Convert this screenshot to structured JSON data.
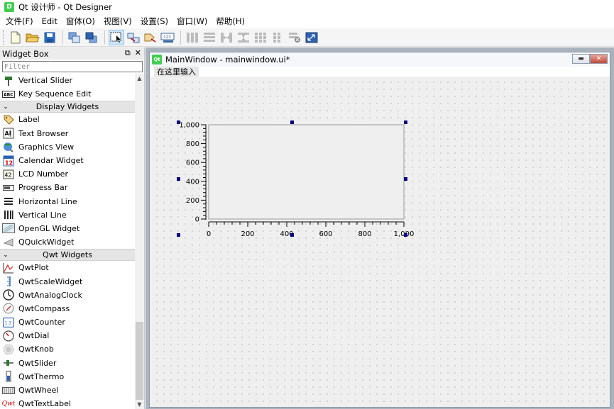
{
  "app": {
    "title": "Qt 设计师 - Qt Designer",
    "icon_label": "D"
  },
  "menu": [
    "文件(F)",
    "Edit",
    "窗体(O)",
    "视图(V)",
    "设置(S)",
    "窗口(W)",
    "帮助(H)"
  ],
  "toolbar": {
    "icons": [
      "new-icon",
      "open-icon",
      "save-icon",
      "send-to-back-icon",
      "bring-to-front-icon",
      "edit-widgets-icon",
      "edit-signals-slots-icon",
      "edit-buddies-icon",
      "edit-tab-order-icon",
      "layout-horizontal-icon",
      "layout-vertical-icon",
      "layout-horizontal-splitter-icon",
      "layout-vertical-splitter-icon",
      "layout-grid-icon",
      "layout-form-icon",
      "break-layout-icon",
      "adjust-size-icon"
    ]
  },
  "widget_box": {
    "title": "Widget Box",
    "filter_placeholder": "Filter",
    "items": [
      {
        "type": "item",
        "label": "Vertical Slider",
        "icon": "vertical-slider-icon"
      },
      {
        "type": "item",
        "label": "Key Sequence Edit",
        "icon": "key-sequence-icon"
      },
      {
        "type": "category",
        "label": "Display Widgets"
      },
      {
        "type": "item",
        "label": "Label",
        "icon": "label-icon"
      },
      {
        "type": "item",
        "label": "Text Browser",
        "icon": "text-browser-icon"
      },
      {
        "type": "item",
        "label": "Graphics View",
        "icon": "graphics-view-icon"
      },
      {
        "type": "item",
        "label": "Calendar Widget",
        "icon": "calendar-icon"
      },
      {
        "type": "item",
        "label": "LCD Number",
        "icon": "lcd-number-icon"
      },
      {
        "type": "item",
        "label": "Progress Bar",
        "icon": "progress-bar-icon"
      },
      {
        "type": "item",
        "label": "Horizontal Line",
        "icon": "horizontal-line-icon"
      },
      {
        "type": "item",
        "label": "Vertical Line",
        "icon": "vertical-line-icon"
      },
      {
        "type": "item",
        "label": "OpenGL Widget",
        "icon": "opengl-icon"
      },
      {
        "type": "item",
        "label": "QQuickWidget",
        "icon": "qquick-icon"
      },
      {
        "type": "category",
        "label": "Qwt Widgets"
      },
      {
        "type": "item",
        "label": "QwtPlot",
        "icon": "qwt-plot-icon"
      },
      {
        "type": "item",
        "label": "QwtScaleWidget",
        "icon": "qwt-scale-icon"
      },
      {
        "type": "item",
        "label": "QwtAnalogClock",
        "icon": "qwt-clock-icon"
      },
      {
        "type": "item",
        "label": "QwtCompass",
        "icon": "qwt-compass-icon"
      },
      {
        "type": "item",
        "label": "QwtCounter",
        "icon": "qwt-counter-icon"
      },
      {
        "type": "item",
        "label": "QwtDial",
        "icon": "qwt-dial-icon"
      },
      {
        "type": "item",
        "label": "QwtKnob",
        "icon": "qwt-knob-icon"
      },
      {
        "type": "item",
        "label": "QwtSlider",
        "icon": "qwt-slider-icon"
      },
      {
        "type": "item",
        "label": "QwtThermo",
        "icon": "qwt-thermo-icon"
      },
      {
        "type": "item",
        "label": "QwtWheel",
        "icon": "qwt-wheel-icon"
      },
      {
        "type": "item",
        "label": "QwtTextLabel",
        "icon": "qwt-textlabel-icon",
        "icon_text": "Qwt"
      }
    ]
  },
  "subwindow": {
    "title": "MainWindow - mainwindow.ui*",
    "icon_label": "Qt",
    "menu_placeholder": "在这里输入"
  },
  "chart_data": {
    "type": "line",
    "x": [],
    "series": [],
    "xlim": [
      0,
      1000
    ],
    "ylim": [
      0,
      1000
    ],
    "x_ticks": [
      "0",
      "200",
      "400",
      "600",
      "800",
      "1,000"
    ],
    "y_ticks": [
      "0",
      "200",
      "400",
      "600",
      "800",
      "1,000"
    ],
    "grid": false,
    "title": "",
    "xlabel": "",
    "ylabel": ""
  },
  "colors": {
    "selection_handle": "#00007f",
    "qt_green": "#41cd52",
    "mdi_background": "#aab3bd"
  }
}
